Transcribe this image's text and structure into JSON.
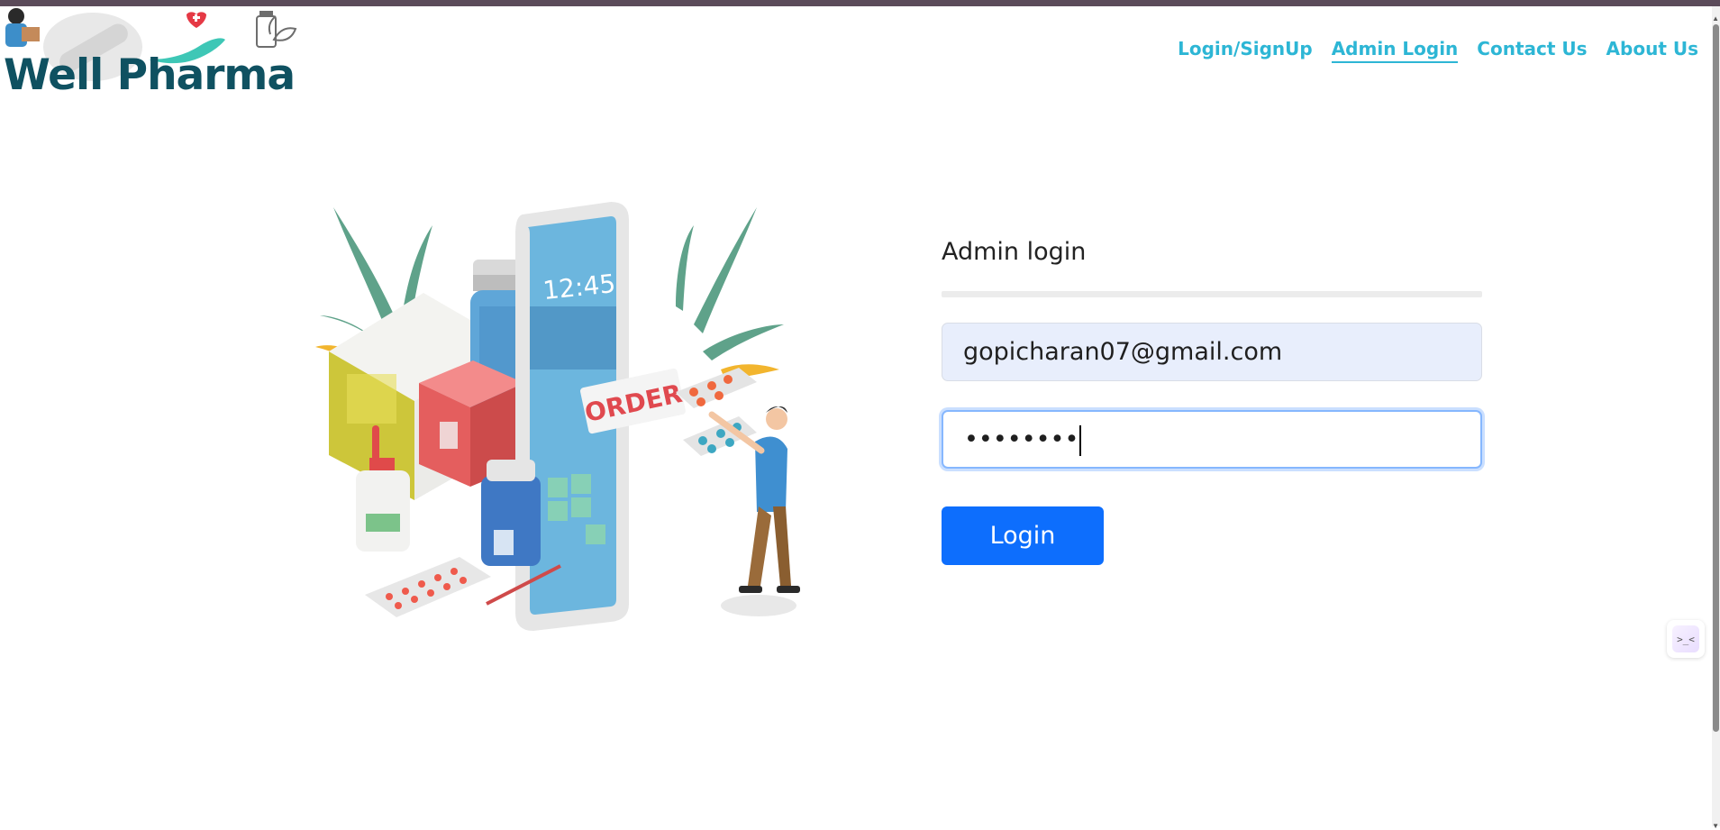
{
  "brand": {
    "name": "Well Pharma"
  },
  "nav": {
    "items": [
      {
        "label": "Login/SignUp",
        "active": false
      },
      {
        "label": "Admin Login",
        "active": true
      },
      {
        "label": "Contact Us",
        "active": false
      },
      {
        "label": "About Us",
        "active": false
      }
    ]
  },
  "illustration": {
    "clock": "12:45",
    "badge": "ORDER"
  },
  "form": {
    "title": "Admin login",
    "email_value": "gopicharan07@gmail.com",
    "password_value": "••••••••",
    "login_label": "Login"
  },
  "colors": {
    "accent": "#2db6d5",
    "primary": "#0d6efd",
    "brand": "#0f5161"
  }
}
